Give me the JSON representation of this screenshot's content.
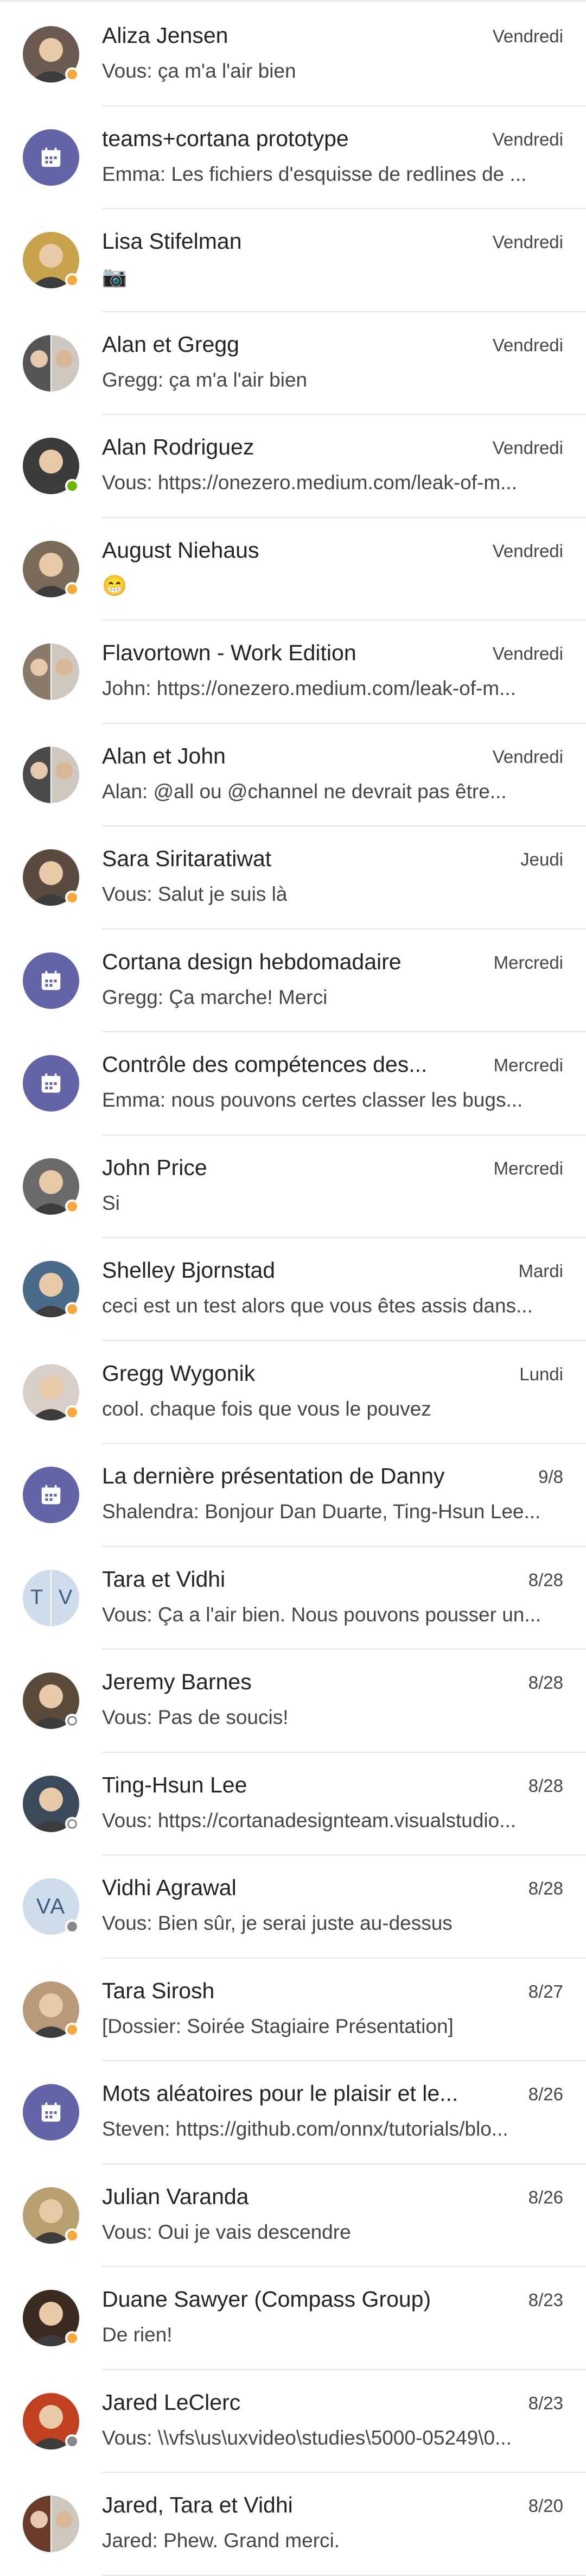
{
  "chats": [
    {
      "name": "Aliza Jensen",
      "time": "Vendredi",
      "preview": "Vous: ça m'a l'air bien",
      "avatar": "photo",
      "presence": "away",
      "photo_color": "#6b5a4f"
    },
    {
      "name": "teams+cortana prototype",
      "time": "Vendredi",
      "preview": "Emma: Les fichiers d'esquisse de redlines de ...",
      "avatar": "meeting",
      "presence": "none"
    },
    {
      "name": "Lisa Stifelman",
      "time": "Vendredi",
      "preview": "📷",
      "avatar": "photo",
      "presence": "away",
      "photo_color": "#c9a34b"
    },
    {
      "name": "Alan et Gregg",
      "time": "Vendredi",
      "preview": "Gregg: ça m'a l'air bien",
      "avatar": "photo-split",
      "presence": "none",
      "photo_color": "#555555"
    },
    {
      "name": "Alan Rodriguez",
      "time": "Vendredi",
      "preview": "Vous: https://onezero.medium.com/leak-of-m...",
      "avatar": "photo",
      "presence": "available",
      "photo_color": "#3a3a3a"
    },
    {
      "name": "August Niehaus",
      "time": "Vendredi",
      "preview": "😁",
      "avatar": "photo",
      "presence": "away",
      "photo_color": "#7a6a5a"
    },
    {
      "name": "Flavortown - Work Edition",
      "time": "Vendredi",
      "preview": "John: https://onezero.medium.com/leak-of-m...",
      "avatar": "photo-split",
      "presence": "none",
      "photo_color": "#8a7a6a"
    },
    {
      "name": "Alan et John",
      "time": "Vendredi",
      "preview": "Alan: @all ou @channel ne devrait pas être...",
      "avatar": "photo-split",
      "presence": "none",
      "photo_color": "#4a4a4a"
    },
    {
      "name": "Sara Siritaratiwat",
      "time": "Jeudi",
      "preview": "Vous: Salut je suis là",
      "avatar": "photo",
      "presence": "away",
      "photo_color": "#5a4a40"
    },
    {
      "name": "Cortana design hebdomadaire",
      "time": "Mercredi",
      "preview": "Gregg: Ça marche! Merci",
      "avatar": "meeting",
      "presence": "none"
    },
    {
      "name": "Contrôle des compétences des...",
      "time": "Mercredi",
      "preview": "Emma: nous pouvons certes classer les bugs...",
      "avatar": "meeting",
      "presence": "none"
    },
    {
      "name": "John Price",
      "time": "Mercredi",
      "preview": "Si",
      "avatar": "photo",
      "presence": "away",
      "photo_color": "#6a6a6a"
    },
    {
      "name": "Shelley Bjornstad",
      "time": "Mardi",
      "preview": "ceci est un test alors que vous êtes assis dans...",
      "avatar": "photo",
      "presence": "away",
      "photo_color": "#4a6a8a"
    },
    {
      "name": "Gregg Wygonik",
      "time": "Lundi",
      "preview": "cool. chaque fois que vous le pouvez",
      "avatar": "photo",
      "presence": "away",
      "photo_color": "#d8d0c8"
    },
    {
      "name": "La dernière présentation de Danny",
      "time": "9/8",
      "preview": "Shalendra: Bonjour Dan Duarte, Ting-Hsun Lee...",
      "avatar": "meeting",
      "presence": "none"
    },
    {
      "name": "Tara et Vidhi",
      "time": "8/28",
      "preview": "Vous: Ça a l'air bien. Nous pouvons pousser un...",
      "avatar": "split-initials",
      "initials": [
        "T",
        "V"
      ],
      "presence": "none"
    },
    {
      "name": "Jeremy Barnes",
      "time": "8/28",
      "preview": "Vous: Pas de soucis!",
      "avatar": "photo",
      "presence": "offline",
      "photo_color": "#5a4a3a"
    },
    {
      "name": "Ting-Hsun Lee",
      "time": "8/28",
      "preview": "Vous: https://cortanadesignteam.visualstudio...",
      "avatar": "photo",
      "presence": "offline",
      "photo_color": "#3a4a5a"
    },
    {
      "name": "Vidhi Agrawal",
      "time": "8/28",
      "preview": "Vous: Bien sûr, je serai juste au-dessus",
      "avatar": "initials",
      "initials": "VA",
      "presence": "unknown"
    },
    {
      "name": "Tara Sirosh",
      "time": "8/27",
      "preview": "[Dossier: Soirée Stagiaire Présentation]",
      "avatar": "photo",
      "presence": "away",
      "photo_color": "#b89a7a"
    },
    {
      "name": "Mots aléatoires pour le plaisir et le...",
      "time": "8/26",
      "preview": "Steven: https://github.com/onnx/tutorials/blo...",
      "avatar": "meeting",
      "presence": "none"
    },
    {
      "name": "Julian Varanda",
      "time": "8/26",
      "preview": "Vous: Oui je vais descendre",
      "avatar": "photo",
      "presence": "away",
      "photo_color": "#b8a070"
    },
    {
      "name": "Duane Sawyer (Compass Group)",
      "time": "8/23",
      "preview": "De rien!",
      "avatar": "photo",
      "presence": "away",
      "photo_color": "#3a2a20"
    },
    {
      "name": "Jared LeClerc",
      "time": "8/23",
      "preview": "Vous: \\\\vfs\\us\\uxvideo\\studies\\5000-05249\\0...",
      "avatar": "photo",
      "presence": "unknown",
      "photo_color": "#c04020"
    },
    {
      "name": "Jared, Tara et Vidhi",
      "time": "8/20",
      "preview": "Jared: Phew. Grand merci.",
      "avatar": "photo-split",
      "presence": "none",
      "photo_color": "#6a3a2a"
    }
  ]
}
